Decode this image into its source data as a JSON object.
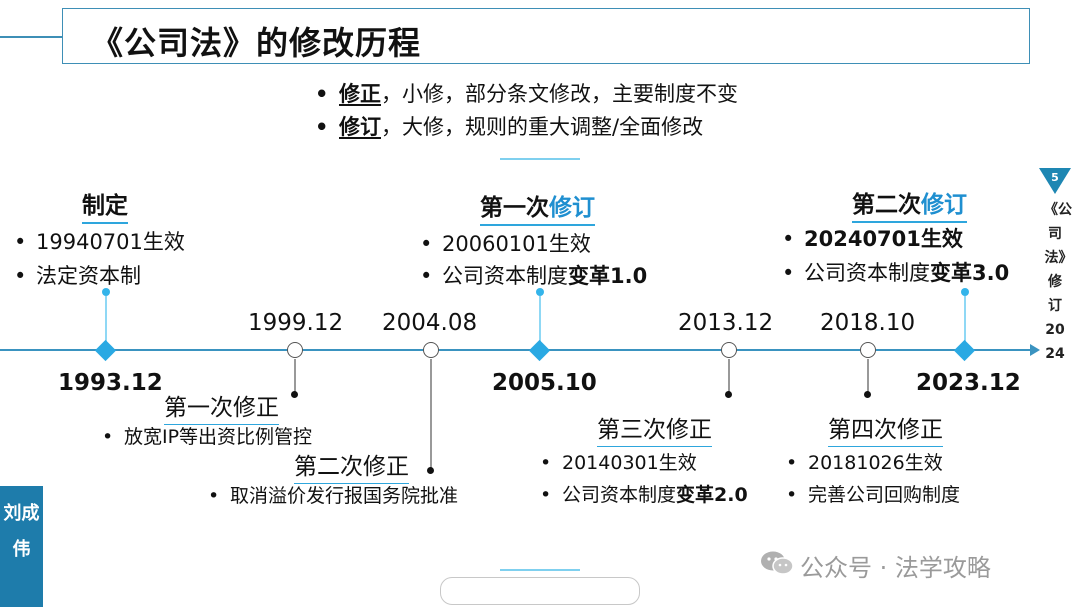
{
  "title": "《公司法》的修改历程",
  "intro": [
    {
      "term": "修正",
      "rest": "，小修，部分条文修改，主要制度不变"
    },
    {
      "term": "修订",
      "rest": "，大修，规则的重大调整/全面修改"
    }
  ],
  "bullet_char": "•",
  "events": {
    "e1993": {
      "year": "1993.12",
      "heading": "制定",
      "items": [
        "19940701生效",
        "法定资本制"
      ]
    },
    "e1999": {
      "year": "1999.12",
      "heading": "第一次修正",
      "items": [
        "放宽IP等出资比例管控"
      ]
    },
    "e2004": {
      "year": "2004.08",
      "heading": "第二次修正",
      "items": [
        "取消溢价发行报国务院批准"
      ]
    },
    "e2005": {
      "year": "2005.10",
      "heading_pre": "第一次",
      "heading_accent": "修订",
      "items": [
        "20060101生效"
      ],
      "item2_pre": "公司资本制度",
      "item2_bold": "变革1.0"
    },
    "e2013": {
      "year": "2013.12",
      "heading": "第三次修正",
      "items": [
        "20140301生效"
      ],
      "item2_pre": "公司资本制度",
      "item2_bold": "变革2.0"
    },
    "e2018": {
      "year": "2018.10",
      "heading": "第四次修正",
      "items": [
        "20181026生效",
        "完善公司回购制度"
      ]
    },
    "e2023": {
      "year": "2023.12",
      "heading_pre": "第二次",
      "heading_accent": "修订",
      "items": [
        "20240701生效"
      ],
      "item2_pre": "公司资本制度",
      "item2_bold": "变革3.0"
    }
  },
  "side": {
    "page_number": "5",
    "text": "《公司法》修订2024"
  },
  "author": "刘成伟",
  "watermark": "公众号 · 法学攻略",
  "colors": {
    "accent": "#1f8fd0",
    "axis": "#3a93c0",
    "diamond": "#2aa9e3",
    "author_bg": "#1e7cab"
  }
}
